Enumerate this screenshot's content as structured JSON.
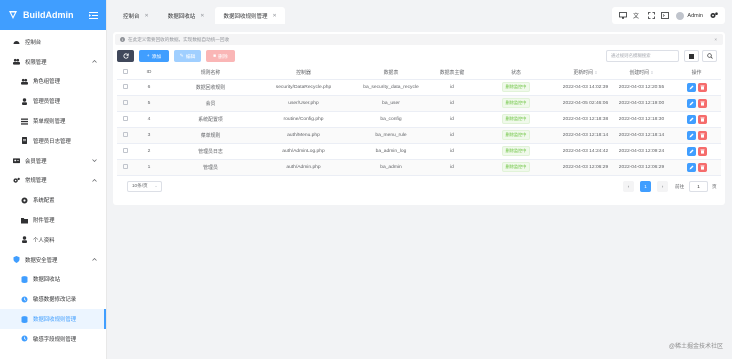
{
  "brand": {
    "title": "BuildAdmin"
  },
  "sidebar": {
    "items": [
      {
        "label": "控制台",
        "icon": "dashboard-icon",
        "level": 0
      },
      {
        "label": "权限管理",
        "icon": "users-icon",
        "level": 0,
        "expanded": true
      },
      {
        "label": "角色组管理",
        "icon": "group-icon",
        "level": 1
      },
      {
        "label": "管理员管理",
        "icon": "user-icon",
        "level": 1
      },
      {
        "label": "菜单规则管理",
        "icon": "list-icon",
        "level": 1
      },
      {
        "label": "管理员日志管理",
        "icon": "log-icon",
        "level": 1
      },
      {
        "label": "会员管理",
        "icon": "idcard-icon",
        "level": 0,
        "expanded": false
      },
      {
        "label": "常规管理",
        "icon": "cogs-icon",
        "level": 0,
        "expanded": true
      },
      {
        "label": "系统配置",
        "icon": "gear-icon",
        "level": 1
      },
      {
        "label": "附件管理",
        "icon": "folder-icon",
        "level": 1
      },
      {
        "label": "个人资料",
        "icon": "person-icon",
        "level": 1
      },
      {
        "label": "数据安全管理",
        "icon": "shield-icon",
        "level": 0,
        "expanded": true
      },
      {
        "label": "数据回收站",
        "icon": "database-icon",
        "level": 1
      },
      {
        "label": "敏感数据修改记录",
        "icon": "clock-icon",
        "level": 1
      },
      {
        "label": "数据回收规则管理",
        "icon": "database-icon",
        "level": 1,
        "active": true
      },
      {
        "label": "敏感字段规则管理",
        "icon": "clock-icon",
        "level": 1
      }
    ]
  },
  "tabs": [
    {
      "label": "控制台",
      "active": false
    },
    {
      "label": "数据回收站",
      "active": false
    },
    {
      "label": "数据回收规则管理",
      "active": true
    }
  ],
  "navbar": {
    "username": "Admin"
  },
  "alert": {
    "text": "在此定义需要回收的数据，实现数据自动统一回收",
    "close": "×"
  },
  "toolbar": {
    "add_label": "添加",
    "edit_label": "编辑",
    "delete_label": "删除",
    "search_placeholder": "通过规则名模糊搜索"
  },
  "table": {
    "columns": [
      "ID",
      "规则名称",
      "控制器",
      "数据表",
      "数据表主键",
      "状态",
      "更新时间",
      "创建时间",
      "操作"
    ],
    "rows": [
      {
        "id": "6",
        "name": "数据回收规则",
        "controller": "security/DataRecycle.php",
        "table": "ba_security_data_recycle",
        "pk": "id",
        "status": "删除监控中",
        "updated": "2022-04-03 14:02:39",
        "created": "2022-04-03 12:20:55"
      },
      {
        "id": "5",
        "name": "会员",
        "controller": "user/User.php",
        "table": "ba_user",
        "pk": "id",
        "status": "删除监控中",
        "updated": "2022-04-05 02:46:06",
        "created": "2022-04-03 12:19:00"
      },
      {
        "id": "4",
        "name": "系统配置项",
        "controller": "routine/Config.php",
        "table": "ba_config",
        "pk": "id",
        "status": "删除监控中",
        "updated": "2022-04-03 12:18:38",
        "created": "2022-04-03 12:18:30"
      },
      {
        "id": "3",
        "name": "菜单规则",
        "controller": "auth/Menu.php",
        "table": "ba_menu_rule",
        "pk": "id",
        "status": "删除监控中",
        "updated": "2022-04-03 12:18:14",
        "created": "2022-04-03 12:18:14"
      },
      {
        "id": "2",
        "name": "管理员日志",
        "controller": "auth/AdminLog.php",
        "table": "ba_admin_log",
        "pk": "id",
        "status": "删除监控中",
        "updated": "2022-04-03 14:24:42",
        "created": "2022-04-03 12:09:24"
      },
      {
        "id": "1",
        "name": "管理员",
        "controller": "auth/Admin.php",
        "table": "ba_admin",
        "pk": "id",
        "status": "删除监控中",
        "updated": "2022-04-03 12:06:29",
        "created": "2022-04-03 12:06:29"
      }
    ]
  },
  "pagination": {
    "page_size": "10条/页",
    "current_page": "1",
    "goto_label": "前往",
    "goto_value": "1",
    "page_unit": "页"
  },
  "watermark": "@稀土掘金技术社区",
  "colors": {
    "primary": "#409eff",
    "danger": "#f56c6c",
    "success": "#67c23a",
    "dark": "#40485b"
  }
}
